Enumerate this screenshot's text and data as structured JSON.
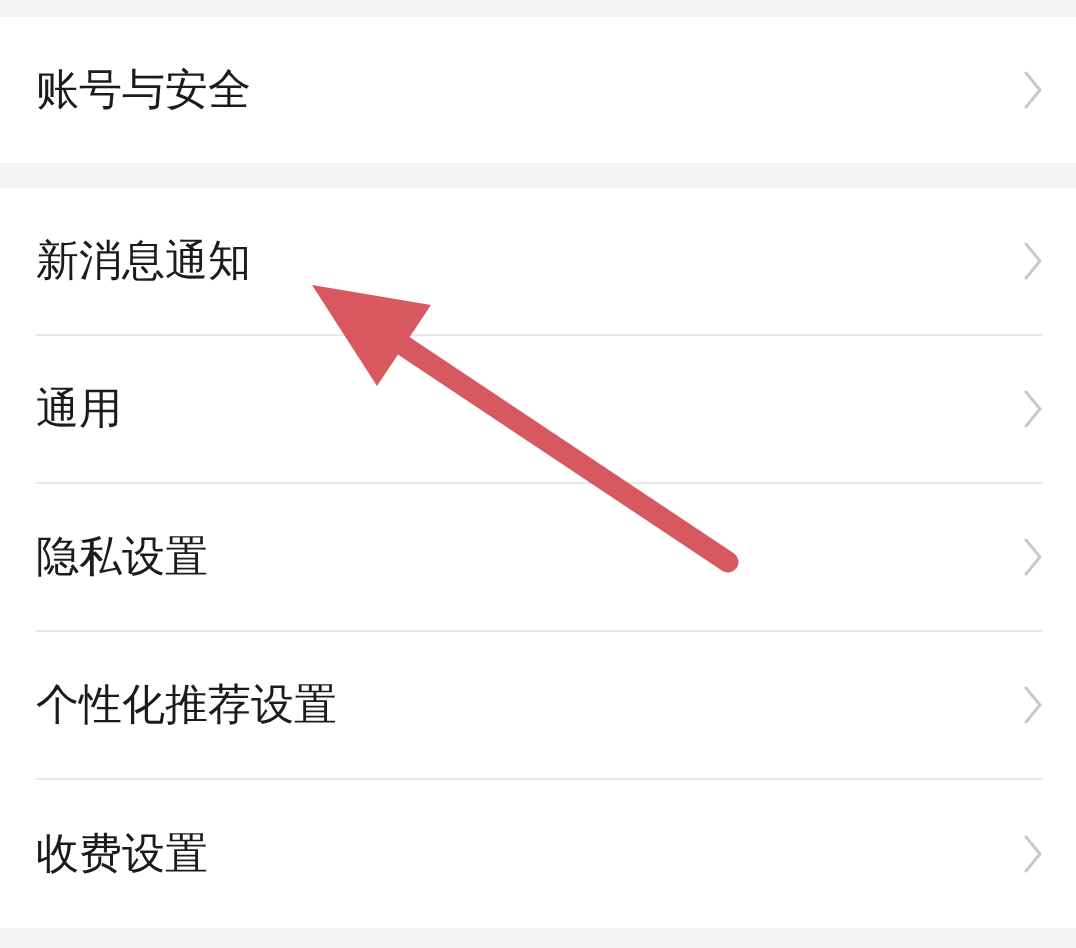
{
  "sections": [
    {
      "items": [
        {
          "label": "账号与安全"
        }
      ]
    },
    {
      "items": [
        {
          "label": "新消息通知"
        },
        {
          "label": "通用"
        },
        {
          "label": "隐私设置"
        },
        {
          "label": "个性化推荐设置"
        },
        {
          "label": "收费设置"
        }
      ]
    }
  ]
}
